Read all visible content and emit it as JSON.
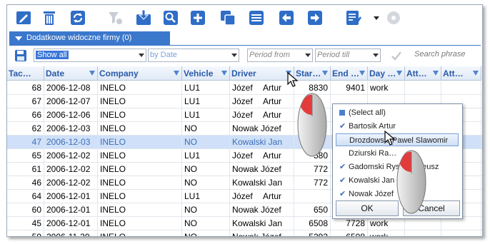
{
  "section": {
    "label": "Dodatkowe widoczne firmy (0)"
  },
  "filters": {
    "view_selected": "Show all",
    "date_filter": "by Date",
    "period_from": "Period from",
    "period_till": "Period till",
    "search_placeholder": "Search phrase"
  },
  "columns": [
    "Tac…",
    "Date",
    "Company",
    "Vehicle",
    "Driver",
    "Star…",
    "End …",
    "Day …",
    "Att…",
    "Att…"
  ],
  "rows": [
    {
      "tac": "68",
      "date": "2006-12-08",
      "company": "INELO",
      "vehicle": "LU1",
      "driver_first": "Józef",
      "driver_last": "Artur",
      "start": "8830",
      "end": "9401",
      "day": "work"
    },
    {
      "tac": "67",
      "date": "2006-12-07",
      "company": "INELO",
      "vehicle": "LU1",
      "driver_first": "Józef",
      "driver_last": "Artur",
      "start": "",
      "end": "",
      "day": ""
    },
    {
      "tac": "66",
      "date": "2006-12-06",
      "company": "INELO",
      "vehicle": "LU1",
      "driver_first": "Józef",
      "driver_last": "Artur",
      "start": "",
      "end": "",
      "day": ""
    },
    {
      "tac": "62",
      "date": "2006-12-03",
      "company": "INELO",
      "vehicle": "NO",
      "driver_first": "Nowak Józef",
      "driver_last": "",
      "start": "",
      "end": "",
      "day": ""
    },
    {
      "tac": "47",
      "date": "2006-12-03",
      "company": "INELO",
      "vehicle": "NO",
      "driver_first": "Kowalski Jan",
      "driver_last": "",
      "start": "",
      "end": "",
      "day": ""
    },
    {
      "tac": "65",
      "date": "2006-12-02",
      "company": "INELO",
      "vehicle": "LU1",
      "driver_first": "Józef",
      "driver_last": "Artur",
      "start": "580",
      "end": "",
      "day": ""
    },
    {
      "tac": "61",
      "date": "2006-12-02",
      "company": "INELO",
      "vehicle": "NO",
      "driver_first": "Nowak Józef",
      "driver_last": "",
      "start": "772",
      "end": "",
      "day": ""
    },
    {
      "tac": "46",
      "date": "2006-12-02",
      "company": "INELO",
      "vehicle": "NO",
      "driver_first": "Kowalski Jan",
      "driver_last": "",
      "start": "772",
      "end": "",
      "day": ""
    },
    {
      "tac": "64",
      "date": "2006-12-01",
      "company": "INELO",
      "vehicle": "LU1",
      "driver_first": "Józef",
      "driver_last": "Artur",
      "start": "",
      "end": "",
      "day": ""
    },
    {
      "tac": "60",
      "date": "2006-12-01",
      "company": "INELO",
      "vehicle": "NO",
      "driver_first": "Nowak Józef",
      "driver_last": "",
      "start": "650",
      "end": "",
      "day": ""
    },
    {
      "tac": "45",
      "date": "2006-12-01",
      "company": "INELO",
      "vehicle": "NO",
      "driver_first": "Kowalski Jan",
      "driver_last": "",
      "start": "6508",
      "end": "7728",
      "day": "work"
    },
    {
      "tac": "59",
      "date": "2006-11-30",
      "company": "INELO",
      "vehicle": "NO",
      "driver_first": "Nowak Józef",
      "driver_last": "",
      "start": "5293",
      "end": "6508",
      "day": "work"
    }
  ],
  "popup": {
    "items": [
      "(Select all)",
      "Bartosik Artur",
      "Drozdowski Pawel Slawomir",
      "Dziurski Ra…",
      "Gadomski Rys… Tadeusz",
      "Kowalski Jan",
      "Nowak Józef"
    ],
    "ok_label": "OK",
    "cancel_label": "Cancel"
  },
  "colors": {
    "accent": "#3b78cc",
    "header_text": "#2a5aa8",
    "selected_row": "#cfe0f8"
  }
}
